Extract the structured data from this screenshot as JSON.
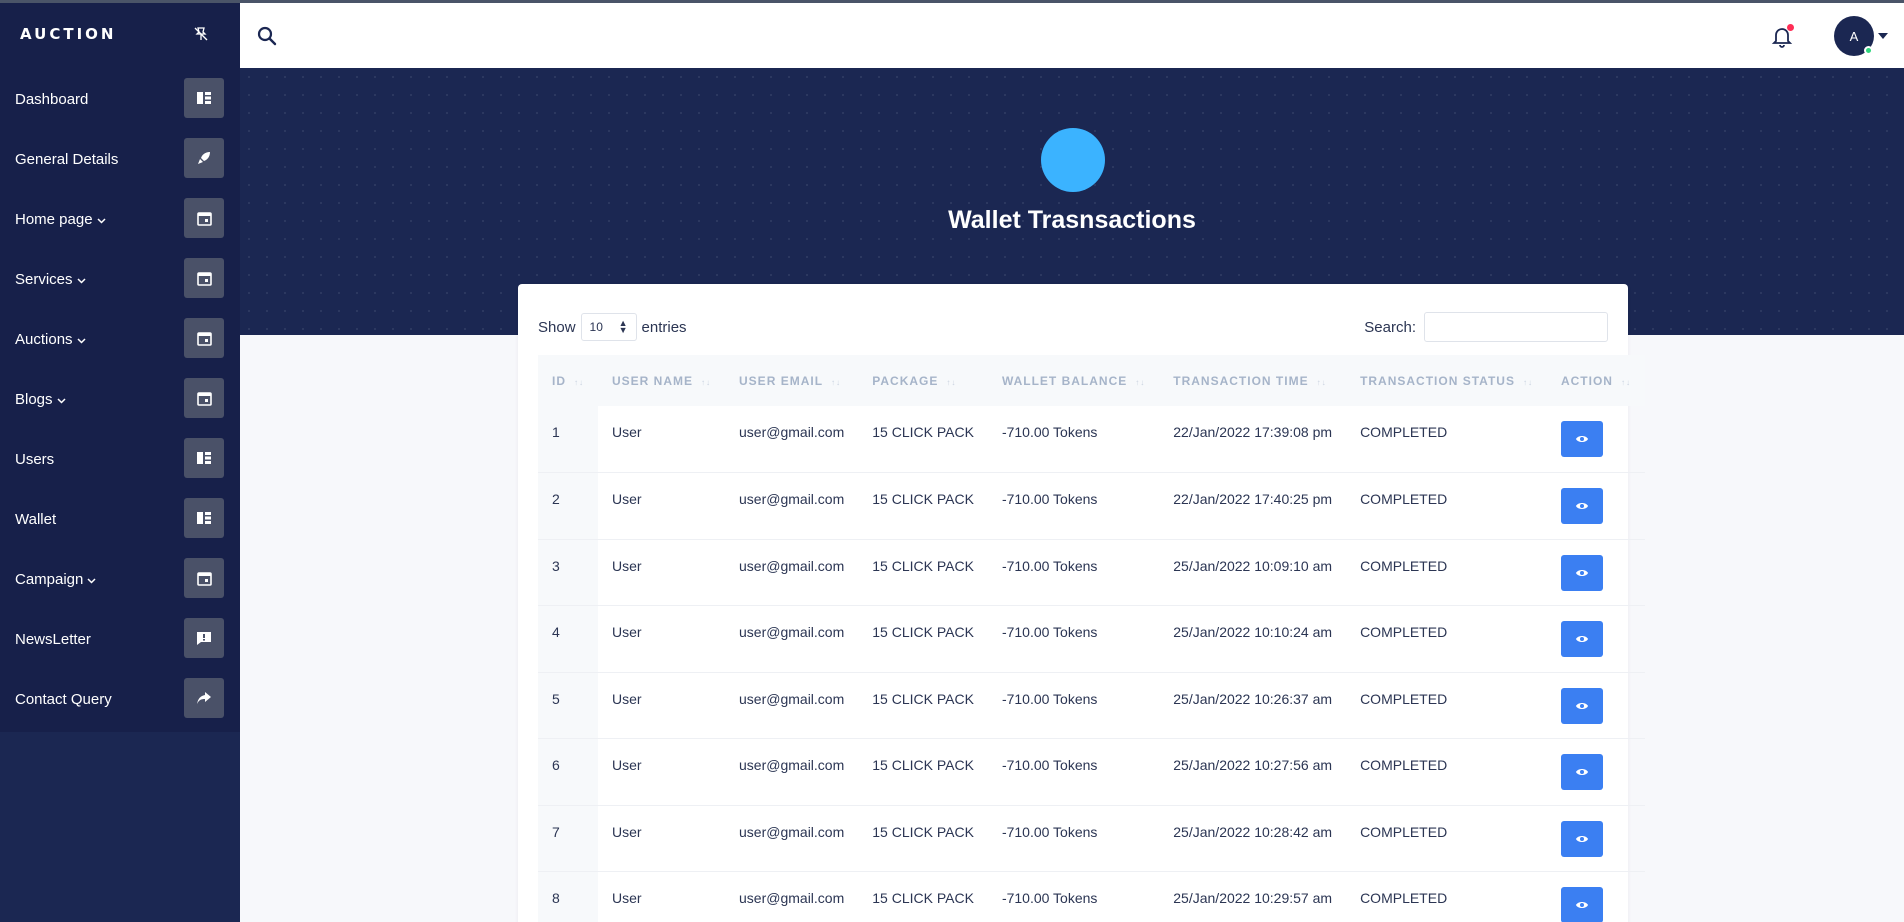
{
  "sidebar": {
    "brand": "AUCTION",
    "items": [
      {
        "label": "Dashboard",
        "icon": "table-icon",
        "dropdown": false
      },
      {
        "label": "General Details",
        "icon": "rocket-icon",
        "dropdown": false
      },
      {
        "label": "Home page",
        "icon": "calendar-icon",
        "dropdown": true
      },
      {
        "label": "Services",
        "icon": "calendar-icon",
        "dropdown": true
      },
      {
        "label": "Auctions",
        "icon": "calendar-icon",
        "dropdown": true
      },
      {
        "label": "Blogs",
        "icon": "calendar-icon",
        "dropdown": true
      },
      {
        "label": "Users",
        "icon": "table-icon",
        "dropdown": false
      },
      {
        "label": "Wallet",
        "icon": "table-icon",
        "dropdown": false
      },
      {
        "label": "Campaign",
        "icon": "calendar-icon",
        "dropdown": true
      },
      {
        "label": "NewsLetter",
        "icon": "message-icon",
        "dropdown": false
      },
      {
        "label": "Contact Query",
        "icon": "share-icon",
        "dropdown": false
      }
    ]
  },
  "topbar": {
    "avatar_initial": "A"
  },
  "hero": {
    "title": "Wallet Trasnsactions"
  },
  "controls": {
    "show_label": "Show",
    "entries_value": "10",
    "entries_label": "entries",
    "search_label": "Search:"
  },
  "table": {
    "headers": [
      "ID",
      "USER NAME",
      "USER EMAIL",
      "PACKAGE",
      "WALLET BALANCE",
      "TRANSACTION TIME",
      "TRANSACTION STATUS",
      "ACTION"
    ],
    "rows": [
      {
        "id": "1",
        "name": "User",
        "email": "user@gmail.com",
        "package": "15 CLICK PACK",
        "balance": "-710.00 Tokens",
        "time": "22/Jan/2022 17:39:08 pm",
        "status": "COMPLETED"
      },
      {
        "id": "2",
        "name": "User",
        "email": "user@gmail.com",
        "package": "15 CLICK PACK",
        "balance": "-710.00 Tokens",
        "time": "22/Jan/2022 17:40:25 pm",
        "status": "COMPLETED"
      },
      {
        "id": "3",
        "name": "User",
        "email": "user@gmail.com",
        "package": "15 CLICK PACK",
        "balance": "-710.00 Tokens",
        "time": "25/Jan/2022 10:09:10 am",
        "status": "COMPLETED"
      },
      {
        "id": "4",
        "name": "User",
        "email": "user@gmail.com",
        "package": "15 CLICK PACK",
        "balance": "-710.00 Tokens",
        "time": "25/Jan/2022 10:10:24 am",
        "status": "COMPLETED"
      },
      {
        "id": "5",
        "name": "User",
        "email": "user@gmail.com",
        "package": "15 CLICK PACK",
        "balance": "-710.00 Tokens",
        "time": "25/Jan/2022 10:26:37 am",
        "status": "COMPLETED"
      },
      {
        "id": "6",
        "name": "User",
        "email": "user@gmail.com",
        "package": "15 CLICK PACK",
        "balance": "-710.00 Tokens",
        "time": "25/Jan/2022 10:27:56 am",
        "status": "COMPLETED"
      },
      {
        "id": "7",
        "name": "User",
        "email": "user@gmail.com",
        "package": "15 CLICK PACK",
        "balance": "-710.00 Tokens",
        "time": "25/Jan/2022 10:28:42 am",
        "status": "COMPLETED"
      },
      {
        "id": "8",
        "name": "User",
        "email": "user@gmail.com",
        "package": "15 CLICK PACK",
        "balance": "-710.00 Tokens",
        "time": "25/Jan/2022 10:29:57 am",
        "status": "COMPLETED"
      }
    ]
  },
  "colors": {
    "sidebar_bg": "#1b2752",
    "hero_bg": "#1b2752",
    "accent_circle": "#3bb3ff",
    "action_button": "#3b7ff2",
    "notification_dot": "#ff2d55",
    "online_dot": "#2fd67e"
  }
}
